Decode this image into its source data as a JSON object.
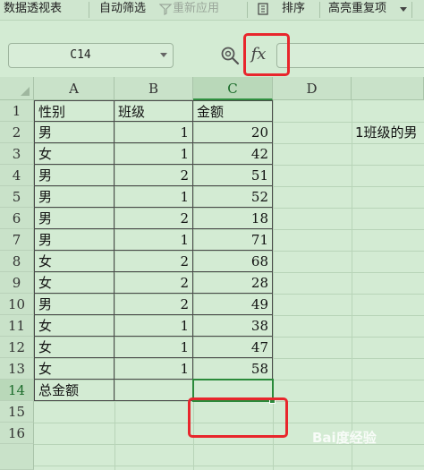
{
  "toolbar": {
    "items": [
      "数据透视表",
      "自动筛选",
      "重新应用",
      "排序",
      "高亮重复项"
    ]
  },
  "formula_bar": {
    "name_box": "C14",
    "fx_label": "fx",
    "formula": ""
  },
  "columns": [
    "A",
    "B",
    "C",
    "D"
  ],
  "rows": [
    "1",
    "2",
    "3",
    "4",
    "5",
    "6",
    "7",
    "8",
    "9",
    "10",
    "11",
    "12",
    "13",
    "14",
    "15",
    "16"
  ],
  "table": {
    "header": [
      "性别",
      "班级",
      "金额"
    ],
    "data": [
      [
        "男",
        "1",
        "20"
      ],
      [
        "女",
        "1",
        "42"
      ],
      [
        "男",
        "2",
        "51"
      ],
      [
        "男",
        "1",
        "52"
      ],
      [
        "男",
        "2",
        "18"
      ],
      [
        "男",
        "1",
        "71"
      ],
      [
        "女",
        "2",
        "68"
      ],
      [
        "女",
        "2",
        "28"
      ],
      [
        "男",
        "2",
        "49"
      ],
      [
        "女",
        "1",
        "38"
      ],
      [
        "女",
        "1",
        "47"
      ],
      [
        "女",
        "1",
        "58"
      ]
    ],
    "total_label": "总金额"
  },
  "note": "1班级的男",
  "selected_cell": "C14",
  "watermark": "Bai度经验",
  "colors": {
    "grid_bg": "#d3ebd3",
    "header_bg": "#c9e2c9",
    "highlight_red": "#e8262c",
    "selection_green": "#2a8a3a"
  }
}
